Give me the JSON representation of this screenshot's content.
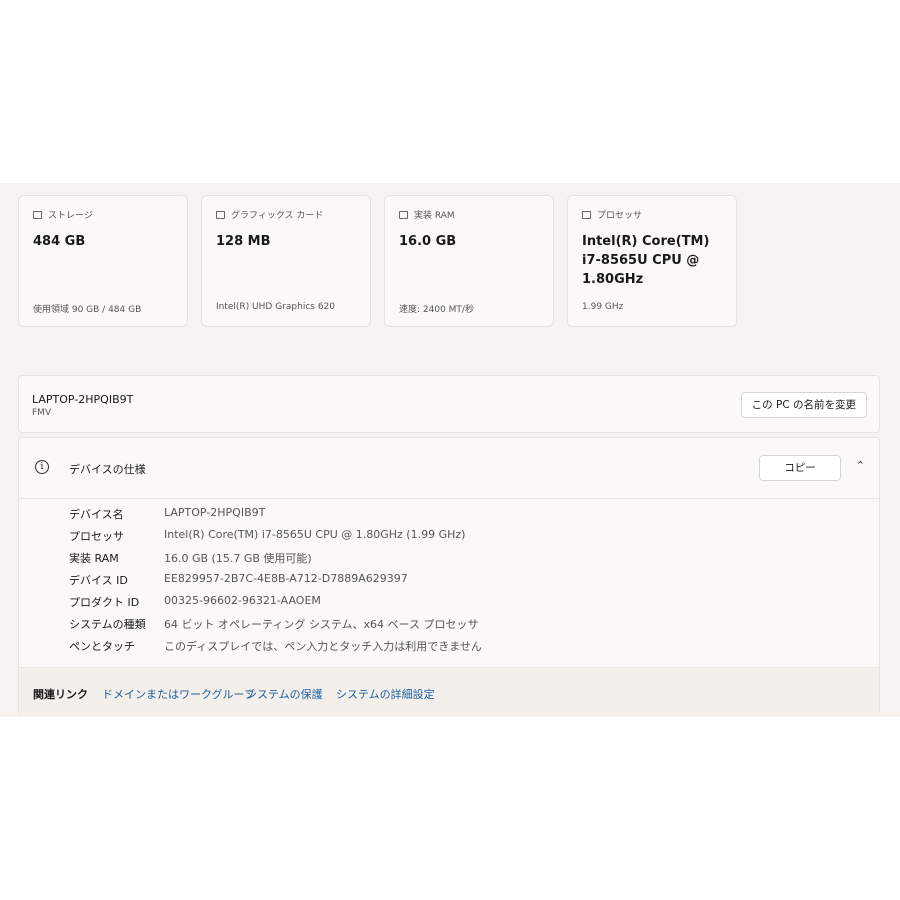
{
  "cards": [
    {
      "label": "ストレージ",
      "icon": "storage-icon",
      "value": "484 GB",
      "sub": "使用領域 90 GB / 484 GB"
    },
    {
      "label": "グラフィックス カード",
      "icon": "graphics-card-icon",
      "value": "128 MB",
      "sub": "Intel(R) UHD Graphics 620"
    },
    {
      "label": "実装 RAM",
      "icon": "ram-icon",
      "value": "16.0 GB",
      "sub": "速度: 2400 MT/秒"
    },
    {
      "label": "プロセッサ",
      "icon": "processor-icon",
      "value": "Intel(R) Core(TM) i7-8565U CPU @ 1.80GHz",
      "sub": "1.99 GHz"
    }
  ],
  "device": {
    "name": "LAPTOP-2HPQIB9T",
    "model": "FMV",
    "rename_label": "この PC の名前を変更"
  },
  "spec": {
    "title": "デバイスの仕様",
    "copy_label": "コピー",
    "rows": [
      {
        "key": "デバイス名",
        "value": "LAPTOP-2HPQIB9T"
      },
      {
        "key": "プロセッサ",
        "value": "Intel(R) Core(TM) i7-8565U CPU @ 1.80GHz (1.99 GHz)"
      },
      {
        "key": "実装 RAM",
        "value": "16.0 GB (15.7 GB 使用可能)"
      },
      {
        "key": "デバイス ID",
        "value": "EE829957-2B7C-4E8B-A712-D7889A629397"
      },
      {
        "key": "プロダクト ID",
        "value": "00325-96602-96321-AAOEM"
      },
      {
        "key": "システムの種類",
        "value": "64 ビット オペレーティング システム、x64 ベース プロセッサ"
      },
      {
        "key": "ペンとタッチ",
        "value": "このディスプレイでは、ペン入力とタッチ入力は利用できません"
      }
    ]
  },
  "related": {
    "label": "関連リンク",
    "links": [
      "ドメインまたはワークグループ",
      "システムの保護",
      "システムの詳細設定"
    ]
  },
  "colors": {
    "panel": "#f6f2ef",
    "card": "#fbf9f7",
    "link": "#1f5fa0"
  }
}
